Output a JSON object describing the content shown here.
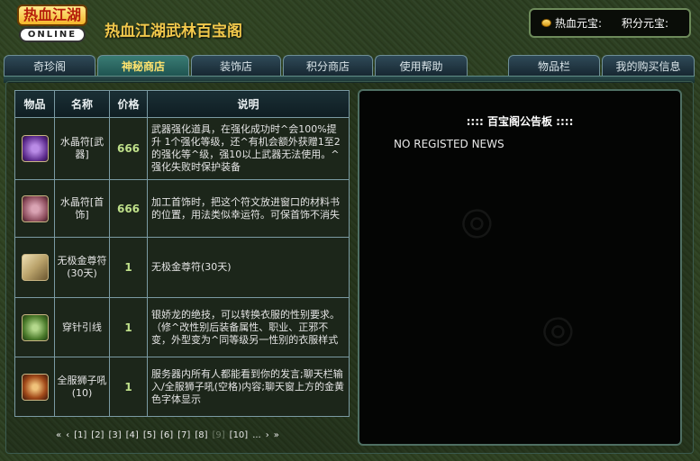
{
  "header": {
    "logo_top": "热血江湖",
    "logo_bottom": "ONLINE",
    "site_title": "热血江湖武林百宝阁",
    "currency_label": "热血元宝:",
    "score_label": "积分元宝:"
  },
  "tabs": {
    "left": [
      {
        "label": "奇珍阁"
      },
      {
        "label": "神秘商店"
      },
      {
        "label": "装饰店"
      },
      {
        "label": "积分商店"
      },
      {
        "label": "使用帮助"
      }
    ],
    "right": [
      {
        "label": "物品栏"
      },
      {
        "label": "我的购买信息"
      }
    ],
    "active": "神秘商店"
  },
  "table": {
    "headers": {
      "icon": "物品",
      "name": "名称",
      "price": "价格",
      "desc": "说明"
    },
    "rows": [
      {
        "icon": "purple-crystal-icon",
        "name": "水晶符[武器]",
        "price": "666",
        "desc": "武器强化道具，在强化成功时^会100%提升 1个强化等级，还^有机会额外获赠1至2的强化等^级，强10以上武器无法使用。^强化失败时保护装备"
      },
      {
        "icon": "pink-crystal-icon",
        "name": "水晶符[首饰]",
        "price": "666",
        "desc": "加工首饰时，把这个符文放进窗口的材料书的位置，用法类似幸运符。可保首饰不消失"
      },
      {
        "icon": "scroll-icon",
        "name": "无极金尊符(30天)",
        "price": "1",
        "desc": "无极金尊符(30天)"
      },
      {
        "icon": "needle-thread-icon",
        "name": "穿针引线",
        "price": "1",
        "desc": "银娇龙的绝技，可以转换衣服的性别要求。（修^改性别后装备属性、职业、正邪不变，外型变为^同等级另一性别的衣服样式"
      },
      {
        "icon": "lion-roar-icon",
        "name": "全服狮子吼(10)",
        "price": "1",
        "desc": "服务器内所有人都能看到你的发言;聊天栏输入/全服狮子吼(空格)内容;聊天窗上方的金黄色字体显示"
      }
    ]
  },
  "pagination": {
    "first": "«",
    "prev": "‹",
    "pages": [
      "[1]",
      "[2]",
      "[3]",
      "[4]",
      "[5]",
      "[6]",
      "[7]",
      "[8]",
      "[9]",
      "[10]"
    ],
    "ellipsis": "...",
    "next": "›",
    "last": "»"
  },
  "notice": {
    "title": ":::: 百宝阁公告板 ::::",
    "body": "NO REGISTED NEWS"
  }
}
